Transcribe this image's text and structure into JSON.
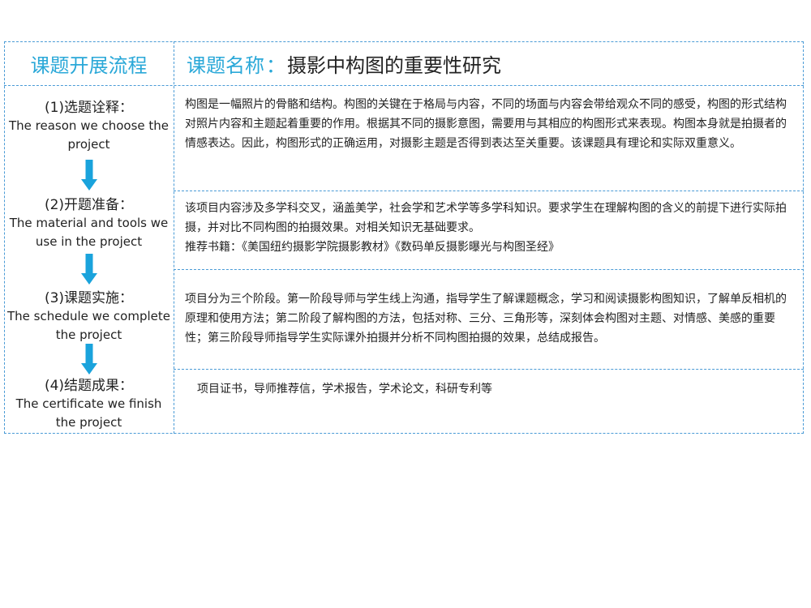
{
  "header": {
    "left_title": "课题开展流程",
    "right_label": "课题名称",
    "right_sep": "：",
    "right_title": "摄影中构图的重要性研究"
  },
  "steps": [
    {
      "cn": "(1)选题诠释：",
      "en": "The reason we choose the project"
    },
    {
      "cn": "(2)开题准备：",
      "en": "The material and tools we use in the project"
    },
    {
      "cn": "(3)课题实施：",
      "en": "The schedule we complete the project"
    },
    {
      "cn": "(4)结题成果：",
      "en": "The certificate we finish the project"
    }
  ],
  "contents": [
    {
      "text": "构图是一幅照片的骨骼和结构。构图的关键在于格局与内容，不同的场面与内容会带给观众不同的感受，构图的形式结构对照片内容和主题起着重要的作用。根据其不同的摄影意图，需要用与其相应的构图形式来表现。构图本身就是拍摄者的情感表达。因此，构图形式的正确运用，对摄影主题是否得到表达至关重要。该课题具有理论和实际双重意义。"
    },
    {
      "text": "该项目内容涉及多学科交叉，涵盖美学，社会学和艺术学等多学科知识。要求学生在理解构图的含义的前提下进行实际拍摄，并对比不同构图的拍摄效果。对相关知识无基础要求。",
      "books": "推荐书籍：《美国纽约摄影学院摄影教材》《数码单反摄影曝光与构图圣经》"
    },
    {
      "text": "项目分为三个阶段。第一阶段导师与学生线上沟通，指导学生了解课题概念，学习和阅读摄影构图知识，了解单反相机的原理和使用方法；第二阶段了解构图的方法，包括对称、三分、三角形等，深刻体会构图对主题、对情感、美感的重要性；第三阶段导师指导学生实际课外拍摄并分析不同构图拍摄的效果，总结成报告。"
    },
    {
      "text": "项目证书，导师推荐信，学术报告，学术论文，科研专利等"
    }
  ],
  "colors": {
    "accent": "#2aa8d8",
    "border": "#4a9bd6",
    "arrow": "#1aa3dc"
  }
}
